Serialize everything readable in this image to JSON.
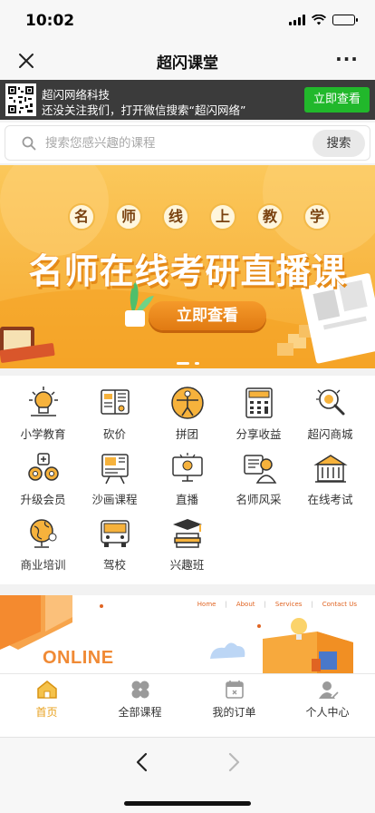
{
  "status": {
    "time": "10:02"
  },
  "nav": {
    "title": "超闪课堂",
    "close_icon": "close-icon",
    "more_label": "···"
  },
  "follow": {
    "account_name": "超闪网络科技",
    "hint": "还没关注我们，打开微信搜索“超闪网络”",
    "button": "立即查看"
  },
  "search": {
    "placeholder": "搜索您感兴趣的课程",
    "button": "搜索"
  },
  "banner": {
    "tagline_chars": [
      "名",
      "师",
      "线",
      "上",
      "教",
      "学"
    ],
    "headline": "名师在线考研直播课",
    "cta": "立即查看",
    "active_slide": 1,
    "slide_count": 2
  },
  "grid": {
    "items": [
      {
        "label": "小学教育",
        "icon": "lightbulb-icon"
      },
      {
        "label": "砍价",
        "icon": "book-icon"
      },
      {
        "label": "拼团",
        "icon": "vitruvian-icon"
      },
      {
        "label": "分享收益",
        "icon": "calculator-icon"
      },
      {
        "label": "超闪商城",
        "icon": "magnifier-icon"
      },
      {
        "label": "升级会员",
        "icon": "gears-icon"
      },
      {
        "label": "沙画课程",
        "icon": "easel-icon"
      },
      {
        "label": "直播",
        "icon": "computer-icon"
      },
      {
        "label": "名师风采",
        "icon": "teacher-icon"
      },
      {
        "label": "在线考试",
        "icon": "school-icon"
      },
      {
        "label": "商业培训",
        "icon": "globe-icon"
      },
      {
        "label": "驾校",
        "icon": "bus-icon"
      },
      {
        "label": "兴趣班",
        "icon": "graduation-icon"
      }
    ]
  },
  "promo": {
    "nav": [
      "Home",
      "About",
      "Services",
      "Contact Us"
    ],
    "online": "ONLINE"
  },
  "tabs": [
    {
      "label": "首页",
      "icon": "home-icon",
      "active": true
    },
    {
      "label": "全部课程",
      "icon": "clover-icon",
      "active": false
    },
    {
      "label": "我的订单",
      "icon": "calendar-icon",
      "active": false
    },
    {
      "label": "个人中心",
      "icon": "user-icon",
      "active": false
    }
  ],
  "colors": {
    "accent": "#e8a11e",
    "follow_button": "#21b82b",
    "banner": "#f8b744"
  }
}
